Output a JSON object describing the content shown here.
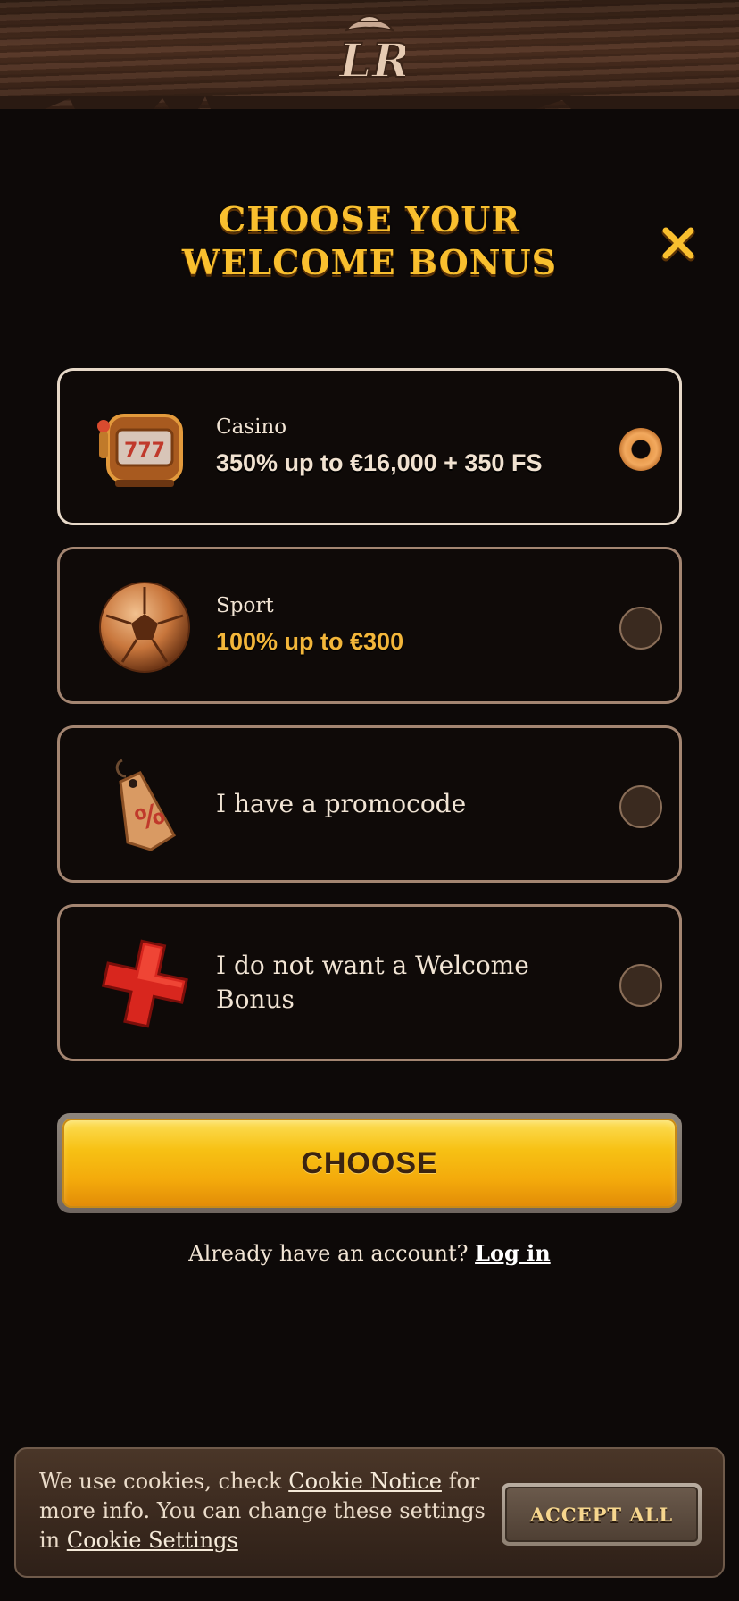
{
  "header": {
    "logo_text": "LR",
    "logo_icon": "lr-cowboy-hat-logo"
  },
  "modal": {
    "title_line1": "CHOOSE YOUR",
    "title_line2": "WELCOME BONUS",
    "close_icon": "close-x-icon"
  },
  "options": [
    {
      "label": "Casino",
      "value": "350% up to €16,000 + 350 FS",
      "icon": "slot-machine-icon",
      "selected": true
    },
    {
      "label": "Sport",
      "value": "100% up to €300",
      "icon": "soccer-ball-icon",
      "selected": false
    },
    {
      "label": "I have a promocode",
      "icon": "percent-tag-icon",
      "selected": false
    },
    {
      "label": "I do not want a Welcome Bonus",
      "icon": "red-cross-icon",
      "selected": false
    }
  ],
  "choose_button": {
    "label": "CHOOSE"
  },
  "account": {
    "prompt": "Already have an account?",
    "login_label": "Log in"
  },
  "cookie": {
    "text_part1": "We use cookies, check ",
    "cookie_notice_link": "Cookie Notice",
    "text_part2": " for more info. You can change these settings in ",
    "cookie_settings_link": "Cookie Settings",
    "accept_label": "ACCEPT ALL"
  },
  "colors": {
    "background": "#0d0908",
    "accent_gold": "#f9bf2e",
    "selected_radio": "#e89a4c",
    "card_border": "#a38571"
  }
}
